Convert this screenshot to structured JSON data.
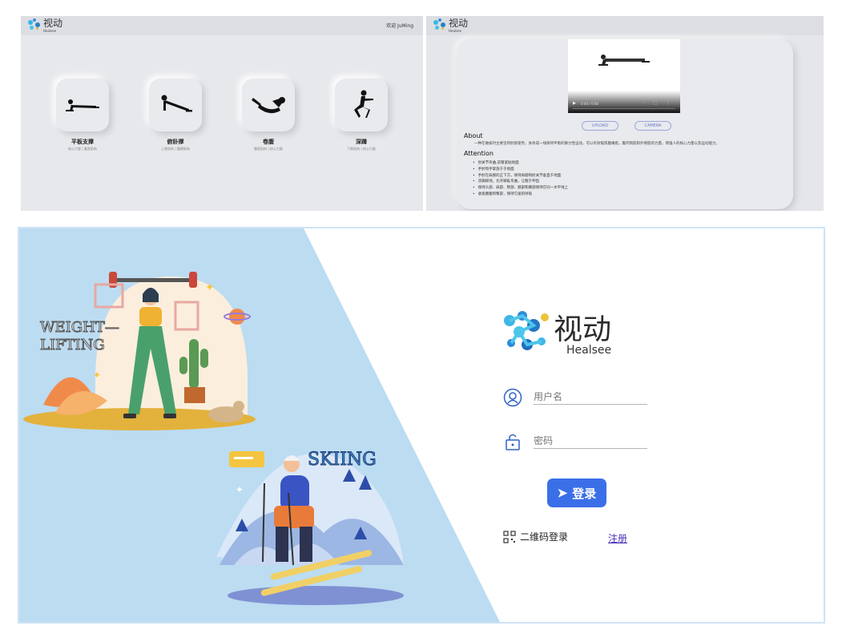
{
  "exercise_page": {
    "logo": {
      "cn": "视动",
      "en": "Healsee"
    },
    "welcome": "欢迎 JuMing",
    "exercises": [
      {
        "name": "平板支撑",
        "muscles": "核心力量 | 腹直肌肉"
      },
      {
        "name": "俯卧撑",
        "muscles": "上肢肌肉 | 腹横肌肉"
      },
      {
        "name": "卷腹",
        "muscles": "腹直肌肉 | 核心力量"
      },
      {
        "name": "深蹲",
        "muscles": "下肢肌肉 | 核心力量"
      }
    ]
  },
  "detail_page": {
    "logo": {
      "cn": "视动",
      "en": "Healsee"
    },
    "video": {
      "time": "0:00 / 0:08"
    },
    "buttons": {
      "upload": "UPLOAD",
      "camera": "CAMERA"
    },
    "about_title": "About",
    "about_text": "一种在做核时主要坚持肘部姿势，身体成一线保持平衡的静力性运动，可以有效锻炼腹横肌，腹内侧肌和外侧肌的力量，增强人的核心力量以及运动能力。",
    "attention_title": "Attention",
    "attention_items": [
      "肘关节弯曲,前臂紧贴地面",
      "手肘和手掌放于于地面",
      "手肘在肩膀的正下方，保持肩膀和肘关节垂直于地面",
      "双脚踩地，允许脚趾弯曲，让髋于伸直",
      "保持头部、肩部、胯部、膝部和踝部保持在同一水平线上",
      "收紧腰腹和臀部，保持匀速的呼吸"
    ]
  },
  "login_page": {
    "illustration_text": {
      "weightlifting_1": "WEIGHT—",
      "weightlifting_2": "LIFTING",
      "skiing": "SKIING"
    },
    "logo": {
      "cn": "视动",
      "en": "Healsee"
    },
    "username_placeholder": "用户名",
    "password_placeholder": "密码",
    "login_button": "登录",
    "qr_login": "二维码登录",
    "register": "注册",
    "colors": {
      "accent": "#3b6fe8",
      "bg_blue": "#bcdcf2",
      "link": "#4a2fb8"
    }
  }
}
